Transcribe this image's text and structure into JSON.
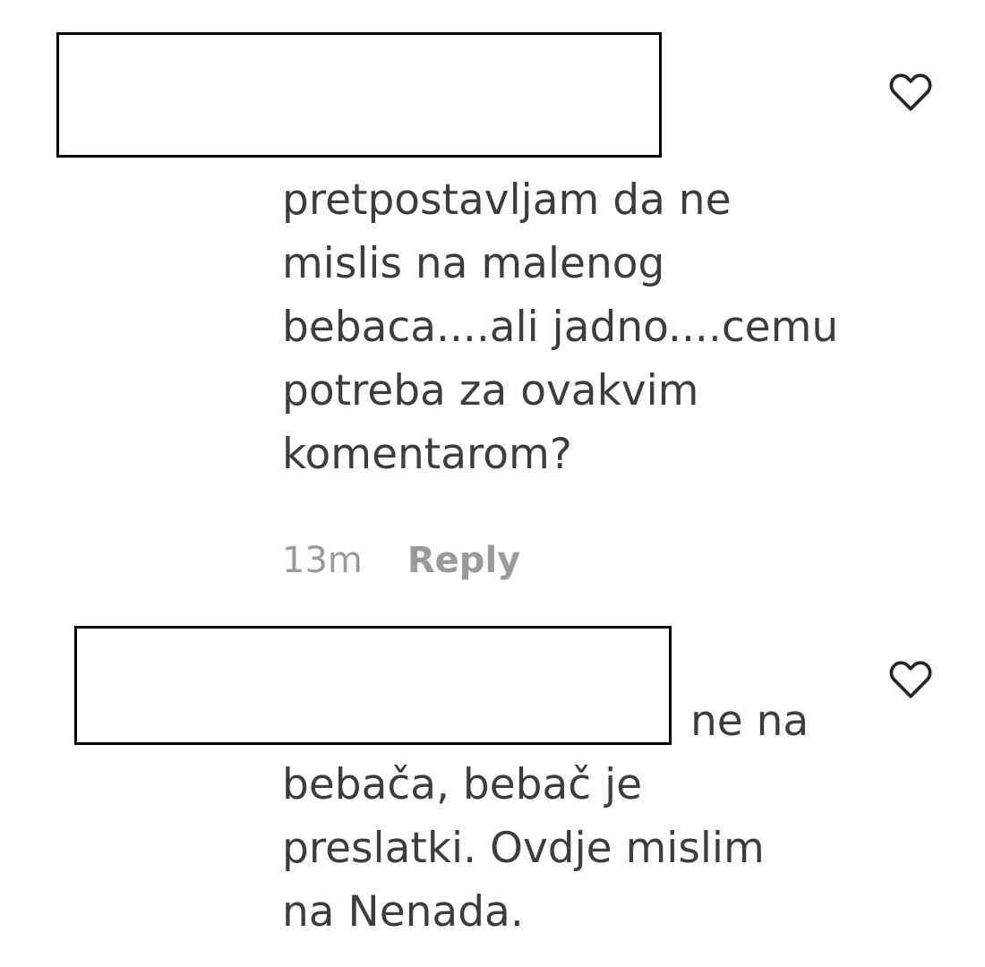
{
  "comments": [
    {
      "text": "pretpostavljam da ne\nmislis na malenog\nbebaca....ali jadno....cemu\npotreba za ovakvim\nkomentarom?",
      "time": "13m",
      "reply_label": "Reply",
      "like_icon": "heart-outline-icon"
    },
    {
      "text": "ne na\nbebača, bebač je\npreslatki. Ovdje mislim\nna Nenada.",
      "like_icon": "heart-outline-icon"
    }
  ]
}
